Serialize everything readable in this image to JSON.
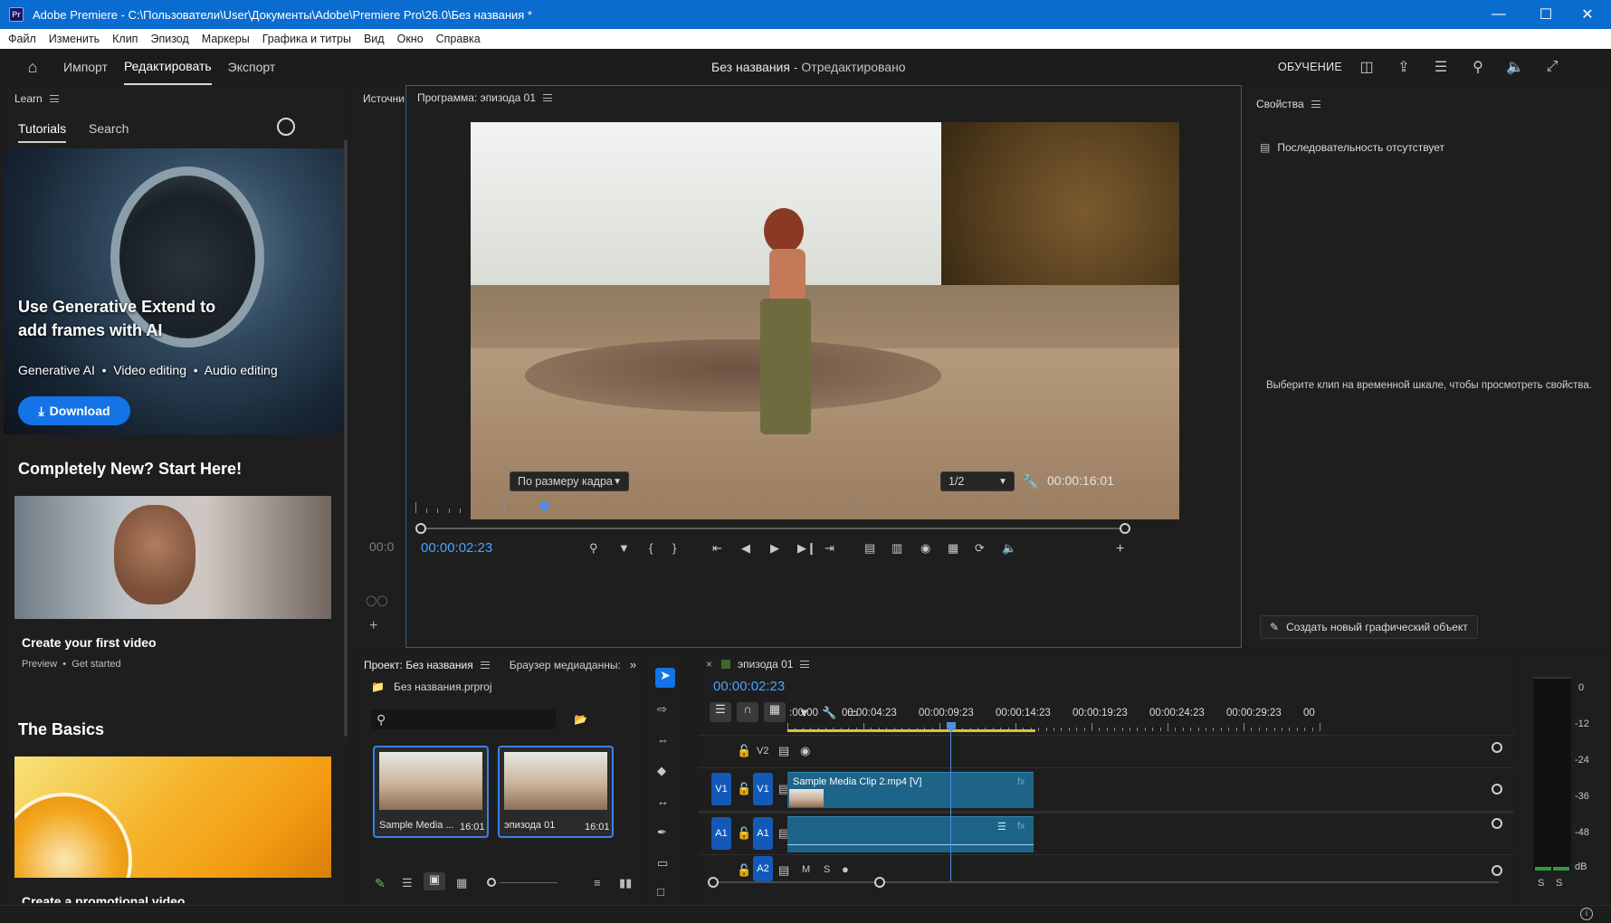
{
  "window": {
    "app_name": "Adobe Premiere",
    "path": " - C:\\Пользователи\\User\\Документы\\Adobe\\Premiere Pro\\26.0\\Без названия *",
    "pr_badge": "Pr"
  },
  "menu": [
    "Файл",
    "Изменить",
    "Клип",
    "Эпизод",
    "Маркеры",
    "Графика и титры",
    "Вид",
    "Окно",
    "Справка"
  ],
  "topnav": {
    "tabs": [
      "Импорт",
      "Редактировать",
      "Экспорт"
    ],
    "active_tab": "Редактировать",
    "project_title": "Без названия",
    "project_status": " - Отредактировано",
    "learn_label": "ОБУЧЕНИЕ"
  },
  "learn": {
    "panel_title": "Learn",
    "tabs": [
      "Tutorials",
      "Search"
    ],
    "hero": {
      "title": "Use Generative Extend to add frames with AI",
      "tags": "Generative AI  •  Video editing  •  Audio editing",
      "download": "Download"
    },
    "section1": "Completely New? Start Here!",
    "card1": {
      "title": "Create your first video",
      "meta": "Preview  •  Get started"
    },
    "section2": "The Basics",
    "card2": {
      "title": "Create a promotional video"
    }
  },
  "source_tab": "Источни",
  "program": {
    "title": "Программа: эпизода 01",
    "timecode": "00:00:02:23",
    "fit": "По размеру кадра",
    "resolution": "1/2",
    "duration": "00:00:16:01",
    "left_tc_stub": "00:0",
    "playhead_progress": 0.182
  },
  "properties": {
    "title": "Свойства",
    "no_sequence": "Последовательность отсутствует",
    "hint": "Выберите клип на временной шкале, чтобы просмотреть свойства.",
    "new_graphic": "Создать новый графический объект"
  },
  "project": {
    "tab": "Проект: Без названия",
    "tab2": "Браузер медиаданны:",
    "file": "Без названия.prproj",
    "items": [
      {
        "name": "Sample Media ...",
        "duration": "16:01"
      },
      {
        "name": "эпизода 01",
        "duration": "16:01"
      }
    ]
  },
  "timeline": {
    "tab": "эпизода 01",
    "timecode": "00:00:02:23",
    "ruler": [
      ":00:00",
      "00:00:04:23",
      "00:00:09:23",
      "00:00:14:23",
      "00:00:19:23",
      "00:00:24:23",
      "00:00:29:23",
      "00"
    ],
    "tracks": {
      "v2": "V2",
      "v1": "V1",
      "a1": "A1",
      "a2": "A2",
      "m": "M",
      "s": "S"
    },
    "clip_label": "Sample Media Clip 2.mp4 [V]",
    "fx": "fx"
  },
  "meter": {
    "scale": [
      "0",
      "-12",
      "-24",
      "-36",
      "-48",
      "dB"
    ],
    "solo": [
      "S",
      "S"
    ]
  },
  "colors": {
    "accent_blue": "#1473e6",
    "timecode_blue": "#4ba3ff",
    "clip_teal": "#1d6488",
    "titlebar": "#0b6cd0"
  }
}
